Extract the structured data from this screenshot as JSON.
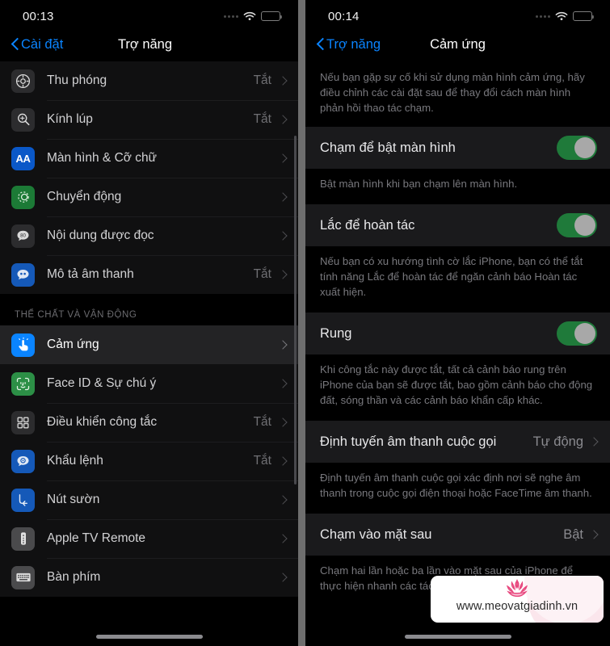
{
  "left": {
    "status": {
      "time": "00:13"
    },
    "nav": {
      "back_label": "Cài đặt",
      "title": "Trợ năng"
    },
    "rows": [
      {
        "label": "Thu phóng",
        "value": "Tắt",
        "icon": "zoom-icon"
      },
      {
        "label": "Kính lúp",
        "value": "Tắt",
        "icon": "magnifier-icon"
      },
      {
        "label": "Màn hình & Cỡ chữ",
        "value": "",
        "icon": "display-text-size-icon"
      },
      {
        "label": "Chuyển động",
        "value": "",
        "icon": "motion-icon"
      },
      {
        "label": "Nội dung được đọc",
        "value": "",
        "icon": "spoken-content-icon"
      },
      {
        "label": "Mô tả âm thanh",
        "value": "Tắt",
        "icon": "audio-description-icon"
      }
    ],
    "section_header": "THỂ CHẤT VÀ VẬN ĐỘNG",
    "rows2": [
      {
        "label": "Cảm ứng",
        "value": "",
        "icon": "touch-icon",
        "selected": true
      },
      {
        "label": "Face ID & Sự chú ý",
        "value": "",
        "icon": "face-id-icon"
      },
      {
        "label": "Điều khiển công tắc",
        "value": "Tắt",
        "icon": "switch-control-icon"
      },
      {
        "label": "Khẩu lệnh",
        "value": "Tắt",
        "icon": "voice-control-icon"
      },
      {
        "label": "Nút sườn",
        "value": "",
        "icon": "side-button-icon"
      },
      {
        "label": "Apple TV Remote",
        "value": "",
        "icon": "apple-tv-remote-icon"
      },
      {
        "label": "Bàn phím",
        "value": "",
        "icon": "keyboard-icon"
      }
    ]
  },
  "right": {
    "status": {
      "time": "00:14"
    },
    "nav": {
      "back_label": "Trợ năng",
      "title": "Cảm ứng"
    },
    "intro_footnote": "Nếu bạn gặp sự cố khi sử dụng màn hình cảm ứng, hãy điều chỉnh các cài đặt sau để thay đổi cách màn hình phản hồi thao tác chạm.",
    "items": [
      {
        "kind": "toggle",
        "title": "Chạm để bật màn hình",
        "on": true,
        "footnote": "Bật màn hình khi bạn chạm lên màn hình."
      },
      {
        "kind": "toggle",
        "title": "Lắc để hoàn tác",
        "on": true,
        "footnote": "Nếu bạn có xu hướng tình cờ lắc iPhone, bạn có thể tắt tính năng Lắc để hoàn tác để ngăn cảnh báo Hoàn tác xuất hiện."
      },
      {
        "kind": "toggle",
        "title": "Rung",
        "on": true,
        "footnote": "Khi công tắc này được tắt, tất cả cảnh báo rung trên iPhone của bạn sẽ được tắt, bao gồm cảnh báo cho động đất, sóng thần và các cảnh báo khẩn cấp khác."
      },
      {
        "kind": "link",
        "title": "Định tuyến âm thanh cuộc gọi",
        "value": "Tự động",
        "footnote": "Định tuyến âm thanh cuộc gọi xác định nơi sẽ nghe âm thanh trong cuộc gọi điện thoại hoặc FaceTime âm thanh."
      },
      {
        "kind": "link",
        "title": "Chạm vào mặt sau",
        "value": "Bật",
        "footnote": "Chạm hai lần hoặc ba lần vào mặt sau của iPhone để thực hiện nhanh các tác vụ."
      }
    ]
  },
  "watermark": {
    "text": "www.meovatgiadinh.vn",
    "logo": "lotus-flower-logo",
    "color": "#e8497f"
  },
  "colors": {
    "accent": "#0a84ff",
    "toggle_on": "#1f7a3a",
    "bg": "#000000",
    "cell": "#1a1a1c"
  }
}
